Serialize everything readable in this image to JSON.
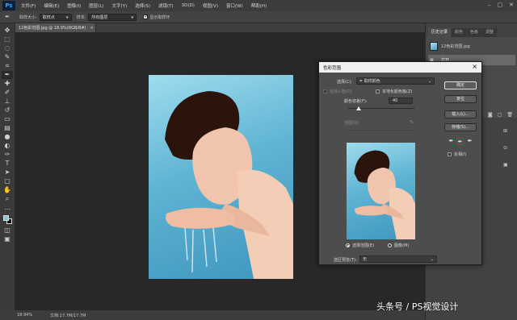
{
  "app": {
    "logo": "Ps"
  },
  "menu": [
    "文件(F)",
    "编辑(E)",
    "图像(I)",
    "图层(L)",
    "文字(Y)",
    "选择(S)",
    "滤镜(T)",
    "3D(D)",
    "视图(V)",
    "窗口(W)",
    "帮助(H)"
  ],
  "options_bar": {
    "tool_icon": "eyedropper-icon",
    "sample_size_label": "取样大小:",
    "sample_size_value": "取样点",
    "sample_label": "样本:",
    "sample_value": "所有图层",
    "show_ring_label": "显示取样环",
    "show_ring_checked": true
  },
  "document": {
    "tab_title": "12色彩范围.jpg @ 18.9%(RGB/8#)",
    "zoom": "18.94%",
    "doc_info": "文档:17.7M/17.7M"
  },
  "panels": {
    "tabs": [
      "历史记录",
      "颜色",
      "色板",
      "调整"
    ],
    "history_items": [
      "12色彩范围.jpg",
      "打开"
    ]
  },
  "dialog": {
    "title": "色彩范围",
    "select_label": "选择(C):",
    "select_value": "取样颜色",
    "detect_faces_label": "检测人脸(D)",
    "localized_label": "本地化颜色簇(Z)",
    "fuzziness_label": "颜色容差(F):",
    "fuzziness_value": "40",
    "range_label": "范围(R):",
    "range_unit": "%",
    "radio_selection": "选择范围(E)",
    "radio_image": "图像(M)",
    "preview_label": "选区预览(T):",
    "preview_value": "无",
    "buttons": {
      "ok": "确定",
      "reset": "复位",
      "load": "载入(L)...",
      "save": "存储(S)..."
    },
    "invert_label": "反相(I)"
  },
  "watermark": "头条号 / PS视觉设计"
}
